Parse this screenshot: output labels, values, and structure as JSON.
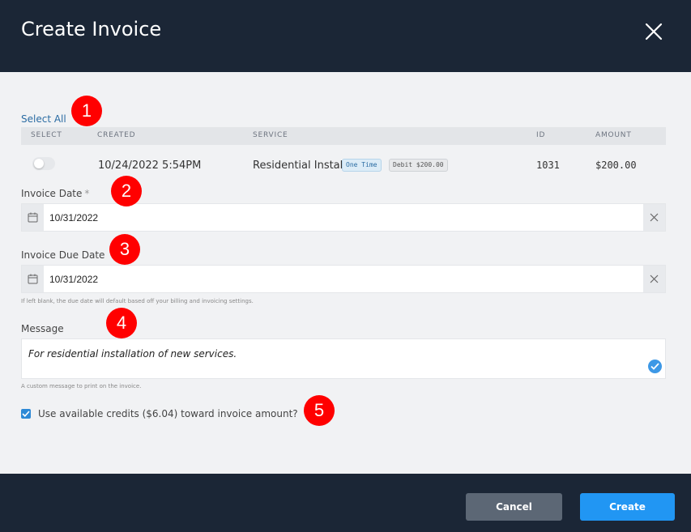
{
  "modal": {
    "title": "Create Invoice"
  },
  "table": {
    "select_all": "Select All",
    "headers": [
      "SELECT",
      "CREATED",
      "SERVICE",
      "ID",
      "AMOUNT"
    ],
    "rows": [
      {
        "selected": false,
        "created": "10/24/2022 5:54PM",
        "service": "Residential Install",
        "badges": [
          "One Time",
          "Debit $200.00"
        ],
        "id": "1031",
        "amount": "$200.00"
      }
    ]
  },
  "invoice_date": {
    "label": "Invoice Date",
    "required_mark": "*",
    "value": "10/31/2022"
  },
  "due_date": {
    "label": "Invoice Due Date",
    "value": "10/31/2022",
    "hint": "If left blank, the due date will default based off your billing and invoicing settings."
  },
  "message": {
    "label": "Message",
    "value": "For residential installation of new services.",
    "hint": "A custom message to print on the invoice."
  },
  "credits": {
    "checked": true,
    "label": "Use available credits ($6.04) toward invoice amount?"
  },
  "footer": {
    "cancel_label": "Cancel",
    "create_label": "Create"
  },
  "markers": [
    "1",
    "2",
    "3",
    "4",
    "5"
  ],
  "colors": {
    "header_bg": "#1b2636",
    "primary": "#2196f3",
    "marker": "#ff0000"
  }
}
